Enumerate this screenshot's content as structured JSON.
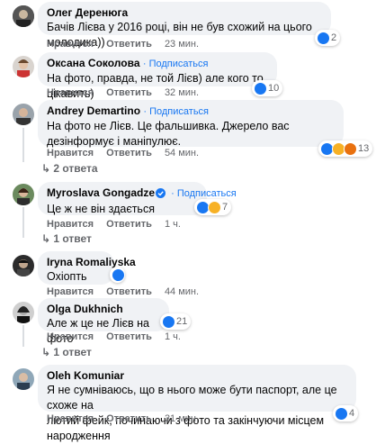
{
  "comments": [
    {
      "name": "Олег Деренюга",
      "follow": "",
      "text": "Бачів Лієва у 2016 році, він не був схожий на цього молодика))",
      "actions": [
        "Нравится",
        "Ответить"
      ],
      "time": "23 мин.",
      "reactions": "2",
      "reaction_icons": [
        "like-icon"
      ]
    },
    {
      "name": "Оксана Соколова",
      "follow": "Подписаться",
      "text": "На фото, правда, не той Лієв) але кого то цікавить)",
      "actions": [
        "Нравится",
        "Ответить"
      ],
      "time": "32 мин.",
      "reactions": "10",
      "reaction_icons": [
        "like-icon"
      ]
    },
    {
      "name": "Andrey Demartino",
      "follow": "Подписаться",
      "text": "На фото не Лієв. Це фальшивка. Джерело вас дезінформує і маніпулює.",
      "actions": [
        "Нравится",
        "Ответить"
      ],
      "time": "54 мин.",
      "reactions": "13",
      "reaction_icons": [
        "like-icon",
        "wow-icon",
        "angry-icon"
      ],
      "replies": "2 ответа"
    },
    {
      "name": "Myroslava Gongadze",
      "follow": "Подписаться",
      "text": "Це ж не він здається",
      "actions": [
        "Нравится",
        "Ответить"
      ],
      "time": "1 ч.",
      "reactions": "7",
      "reaction_icons": [
        "like-icon",
        "haha-icon"
      ],
      "replies": "1 ответ"
    },
    {
      "name": "Iryna Romaliyska",
      "follow": "",
      "text": "Охіопть",
      "actions": [
        "Нравится",
        "Ответить"
      ],
      "time": "44 мин.",
      "reactions": "",
      "reaction_icons": [
        "like-icon"
      ]
    },
    {
      "name": "Olga Dukhnich",
      "follow": "",
      "text": "Але ж це не Лієв на фото",
      "actions": [
        "Нравится",
        "Ответить"
      ],
      "time": "1 ч.",
      "reactions": "21",
      "reaction_icons": [
        "like-icon"
      ],
      "replies": "1 ответ"
    },
    {
      "name": "Oleh Komuniar",
      "follow": "",
      "text_lines": [
        "Я не сумніваюсь, що в нього може бути паспорт, але це схоже на",
        "лютий фейк, починаючи з фото та закінчуючи місцем народження"
      ],
      "actions": [
        "Нравится",
        "Ответить"
      ],
      "time": "31 мин.",
      "reactions": "4",
      "reaction_icons": [
        "like-icon"
      ]
    }
  ],
  "colors": {
    "bubble": "#f0f2f5",
    "link": "#1877f2",
    "meta": "#65676b"
  }
}
